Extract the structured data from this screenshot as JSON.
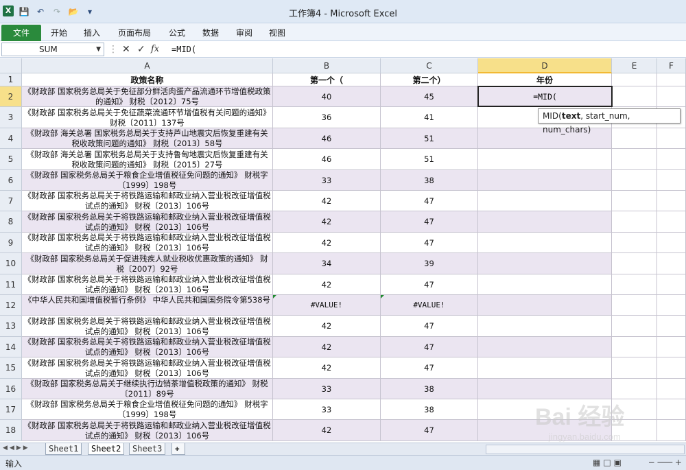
{
  "window": {
    "title": "工作簿4 - Microsoft Excel",
    "app_icon": "X"
  },
  "ribbon": {
    "file_tab": "文件",
    "tabs": [
      "开始",
      "插入",
      "页面布局",
      "公式",
      "数据",
      "审阅",
      "视图"
    ]
  },
  "formula_bar": {
    "name_box": "SUM",
    "fx_label": "fx",
    "formula": "=MID("
  },
  "columns": [
    "A",
    "B",
    "C",
    "D",
    "E",
    "F"
  ],
  "header_row": {
    "row": "1",
    "a": "政策名称",
    "b": "第一个（",
    "c": "第二个）",
    "d": "年份"
  },
  "rows": [
    {
      "n": "2",
      "a": "《财政部 国家税务总局关于免征部分鲜活肉蛋产品流通环节增值税政策的通知》 财税〔2012〕75号",
      "b": "40",
      "c": "45"
    },
    {
      "n": "3",
      "a": "《财政部 国家税务总局关于免征蔬菜流通环节增值税有关问题的通知》 财税〔2011〕137号",
      "b": "36",
      "c": "41"
    },
    {
      "n": "4",
      "a": "《财政部 海关总署 国家税务总局关于支持芦山地震灾后恢复重建有关税收政策问题的通知》 财税〔2013〕58号",
      "b": "46",
      "c": "51"
    },
    {
      "n": "5",
      "a": "《财政部 海关总署 国家税务总局关于支持鲁甸地震灾后恢复重建有关税收政策问题的通知》 财税〔2015〕27号",
      "b": "46",
      "c": "51"
    },
    {
      "n": "6",
      "a": "《财政部 国家税务总局关于粮食企业增值税征免问题的通知》 财税字〔1999〕198号",
      "b": "33",
      "c": "38"
    },
    {
      "n": "7",
      "a": "《财政部 国家税务总局关于将铁路运输和邮政业纳入营业税改征增值税试点的通知》 财税〔2013〕106号",
      "b": "42",
      "c": "47"
    },
    {
      "n": "8",
      "a": "《财政部 国家税务总局关于将铁路运输和邮政业纳入营业税改征增值税试点的通知》 财税〔2013〕106号",
      "b": "42",
      "c": "47"
    },
    {
      "n": "9",
      "a": "《财政部 国家税务总局关于将铁路运输和邮政业纳入营业税改征增值税试点的通知》 财税〔2013〕106号",
      "b": "42",
      "c": "47"
    },
    {
      "n": "10",
      "a": "《财政部 国家税务总局关于促进残疾人就业税收优惠政策的通知》 财税〔2007〕92号",
      "b": "34",
      "c": "39"
    },
    {
      "n": "11",
      "a": "《财政部 国家税务总局关于将铁路运输和邮政业纳入营业税改征增值税试点的通知》 财税〔2013〕106号",
      "b": "42",
      "c": "47"
    },
    {
      "n": "12",
      "a": "《中华人民共和国增值税暂行条例》 中华人民共和国国务院令第538号",
      "b": "#VALUE!",
      "c": "#VALUE!"
    },
    {
      "n": "13",
      "a": "《财政部 国家税务总局关于将铁路运输和邮政业纳入营业税改征增值税试点的通知》 财税〔2013〕106号",
      "b": "42",
      "c": "47"
    },
    {
      "n": "14",
      "a": "《财政部 国家税务总局关于将铁路运输和邮政业纳入营业税改征增值税试点的通知》 财税〔2013〕106号",
      "b": "42",
      "c": "47"
    },
    {
      "n": "15",
      "a": "《财政部 国家税务总局关于将铁路运输和邮政业纳入营业税改征增值税试点的通知》 财税〔2013〕106号",
      "b": "42",
      "c": "47"
    },
    {
      "n": "16",
      "a": "《财政部 国家税务总局关于继续执行边销茶增值税政策的通知》 财税〔2011〕89号",
      "b": "33",
      "c": "38"
    },
    {
      "n": "17",
      "a": "《财政部 国家税务总局关于粮食企业增值税征免问题的通知》 财税字〔1999〕198号",
      "b": "33",
      "c": "38"
    },
    {
      "n": "18",
      "a": "《财政部 国家税务总局关于将铁路运输和邮政业纳入营业税改征增值税试点的通知》 财税〔2013〕106号",
      "b": "42",
      "c": "47"
    }
  ],
  "active_cell": {
    "value": "=MID("
  },
  "tooltip": {
    "fn": "MID(",
    "arg1": "text",
    "rest": ", start_num, num_chars)"
  },
  "sheets": [
    "Sheet1",
    "Sheet2",
    "Sheet3"
  ],
  "status": {
    "mode": "输入"
  },
  "watermark": {
    "line1": "Bai 经验",
    "line2": "jingyan.baidu.com"
  }
}
